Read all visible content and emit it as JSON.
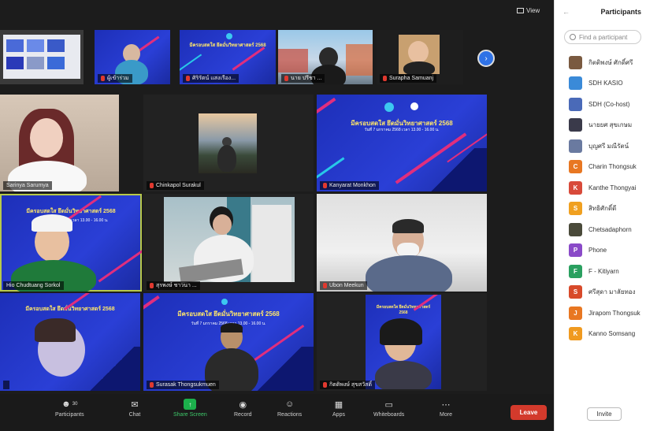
{
  "view": {
    "label": "View"
  },
  "tiles": [
    {
      "name": ""
    },
    {
      "name": "ผู้เข้าร่วม"
    },
    {
      "name": "ศิริรัตน์ แสงเรือง..."
    },
    {
      "name": "นาย ปรีชา ..."
    },
    {
      "name": "Surapha Samuanj"
    },
    {
      "name": "Sarinya Sarumya"
    },
    {
      "name": "Chinkapol Surakul"
    },
    {
      "name": "Kanyarat Monkhon"
    },
    {
      "name": "Hio Chudtuang Sorkol"
    },
    {
      "name": "สุรพงษ์ ชาวนา ..."
    },
    {
      "name": "Ubon Meekun"
    },
    {
      "name": ""
    },
    {
      "name": "Surasak Thongsukmuen"
    },
    {
      "name": "กิตติพงษ์ สุขสวัสดิ์"
    }
  ],
  "slide": {
    "title": "มีครอบสดใส ยึดมั่นวิทยาศาสตร์ 2568",
    "subtitle": "วันที่ 7 มกราคม 2568 เวลา 13.00 - 16.00 น."
  },
  "toolbar": {
    "items": [
      {
        "label": "Participants",
        "count": "30"
      },
      {
        "label": "Chat"
      },
      {
        "label": "Share Screen"
      },
      {
        "label": "Record"
      },
      {
        "label": "Reactions"
      },
      {
        "label": "Apps"
      },
      {
        "label": "Whiteboards"
      },
      {
        "label": "More"
      }
    ],
    "leave": "Leave"
  },
  "panel": {
    "title": "Participants",
    "search_placeholder": "Find a participant",
    "invite": "Invite",
    "participants": [
      {
        "name": "กิตติพงษ์ ศักดิ์ศรี",
        "initial": "",
        "color": "#7a5a40"
      },
      {
        "name": "SDH KASIO",
        "initial": "",
        "color": "#3a8ad8"
      },
      {
        "name": "SDH (Co-host)",
        "initial": "",
        "color": "#4a6ab8"
      },
      {
        "name": "นายยศ สุขเกษม",
        "initial": "",
        "color": "#3a3a4a"
      },
      {
        "name": "บุญศรี มณีรัตน์",
        "initial": "",
        "color": "#6a7aa0"
      },
      {
        "name": "Charin Thongsuk",
        "initial": "C",
        "color": "#e87722"
      },
      {
        "name": "Kanthe Thongyai",
        "initial": "K",
        "color": "#d84a3a"
      },
      {
        "name": "สิทธิศักดิ์ดี",
        "initial": "S",
        "color": "#f0a020"
      },
      {
        "name": "Chetsadaphorn",
        "initial": "",
        "color": "#4a4a3a"
      },
      {
        "name": "Phone",
        "initial": "P",
        "color": "#8a4ac8"
      },
      {
        "name": "F - Kitiyarn",
        "initial": "F",
        "color": "#2aa060"
      },
      {
        "name": "ศรีสุดา มาลัยทอง",
        "initial": "S",
        "color": "#d84a2a"
      },
      {
        "name": "Jirapom Thongsuk",
        "initial": "J",
        "color": "#e87722"
      },
      {
        "name": "Kanno Somsang",
        "initial": "K",
        "color": "#f09a20"
      }
    ]
  }
}
